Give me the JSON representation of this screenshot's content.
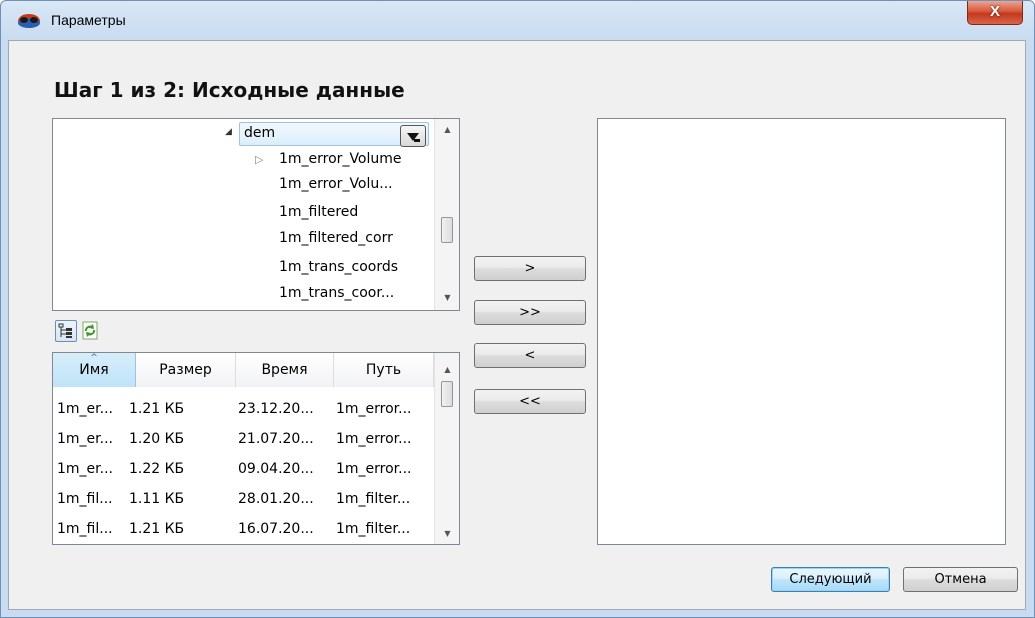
{
  "window": {
    "title": "Параметры",
    "close_glyph": "X",
    "icon": "app-icon"
  },
  "heading": "Шаг 1 из 2: Исходные данные",
  "tree": {
    "root": "dem",
    "items": [
      "1m_error_Volume",
      "1m_error_Volu...",
      "1m_filtered",
      "1m_filtered_corr",
      "1m_trans_coords",
      "1m_trans_coor..."
    ],
    "scroll_position": 0.55
  },
  "toolbar": {
    "tree_view_icon": "tree-view-icon",
    "refresh_icon": "refresh-icon"
  },
  "table": {
    "columns": [
      "Имя",
      "Размер",
      "Время",
      "Путь"
    ],
    "sorted_column": "Имя",
    "rows": [
      [
        "1m_er...",
        "1.21 КБ",
        "23.12.20...",
        "1m_error..."
      ],
      [
        "1m_er...",
        "1.20 КБ",
        "21.07.20...",
        "1m_error..."
      ],
      [
        "1m_er...",
        "1.22 КБ",
        "09.04.20...",
        "1m_error..."
      ],
      [
        "1m_fil...",
        "1.11 КБ",
        "28.01.20...",
        "1m_filter..."
      ],
      [
        "1m_fil...",
        "1.21 КБ",
        "16.07.20...",
        "1m_filter..."
      ]
    ]
  },
  "transfer_buttons": {
    "add": ">",
    "add_all": ">>",
    "remove": "<",
    "remove_all": "<<"
  },
  "footer": {
    "next_label": "Следующий",
    "cancel_label": "Отмена"
  },
  "colors": {
    "title_bar": "#c8dbf0",
    "close_button": "#c3381b",
    "default_button_border": "#3c7fb1"
  }
}
